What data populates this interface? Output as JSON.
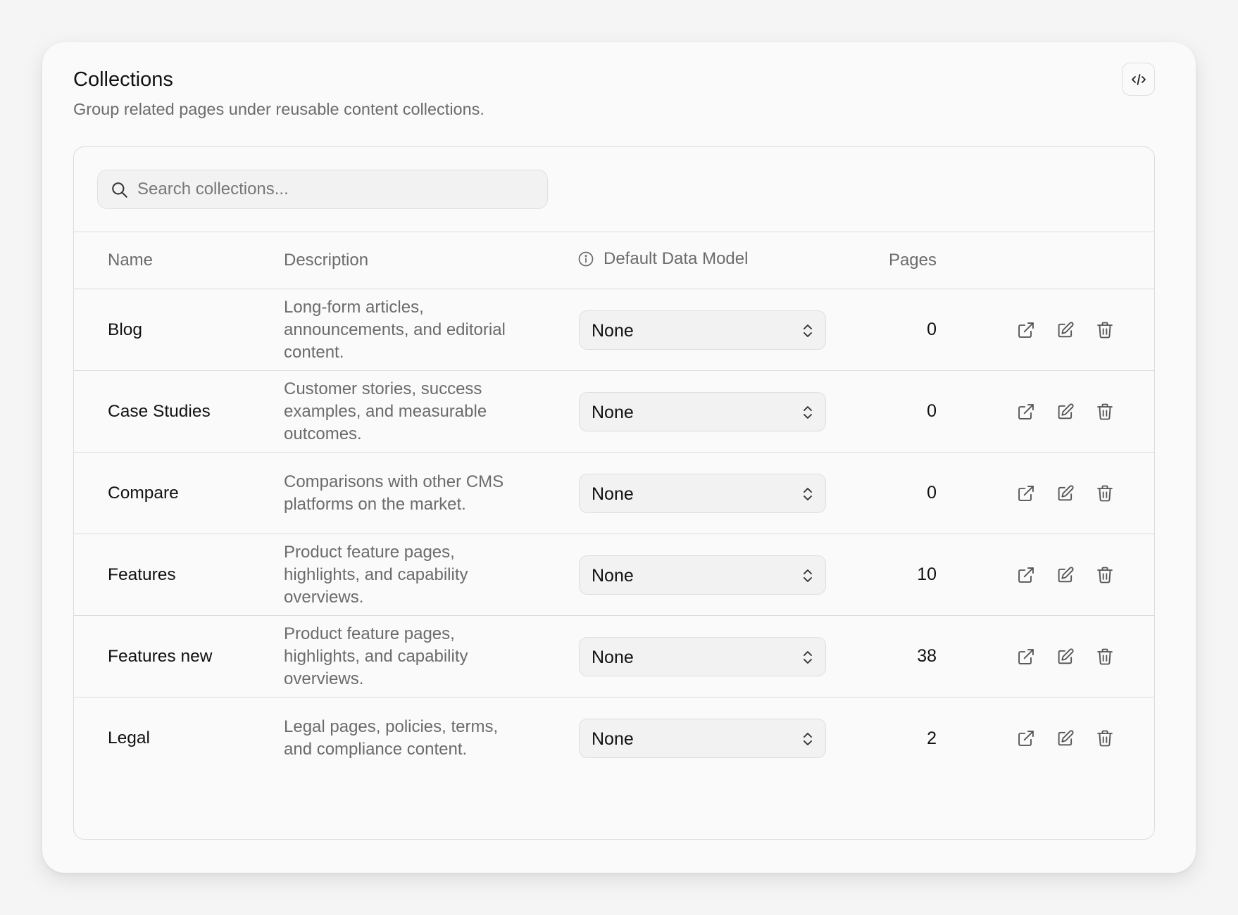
{
  "header": {
    "title": "Collections",
    "subtitle": "Group related pages under reusable content collections."
  },
  "toolbar": {
    "code_icon": "code-icon"
  },
  "search": {
    "placeholder": "Search collections...",
    "value": ""
  },
  "table": {
    "columns": {
      "name": "Name",
      "description": "Description",
      "model": "Default Data Model",
      "pages": "Pages"
    },
    "rows": [
      {
        "name": "Blog",
        "description": "Long-form articles, announcements, and editorial content.",
        "model": "None",
        "pages": "0"
      },
      {
        "name": "Case Studies",
        "description": "Customer stories, success examples, and measurable outcomes.",
        "model": "None",
        "pages": "0"
      },
      {
        "name": "Compare",
        "description": "Comparisons with other CMS platforms on the market.",
        "model": "None",
        "pages": "0"
      },
      {
        "name": "Features",
        "description": "Product feature pages, highlights, and capability overviews.",
        "model": "None",
        "pages": "10"
      },
      {
        "name": "Features new",
        "description": "Product feature pages, highlights, and capability overviews.",
        "model": "None",
        "pages": "38"
      },
      {
        "name": "Legal",
        "description": "Legal pages, policies, terms, and compliance content.",
        "model": "None",
        "pages": "2"
      }
    ],
    "row_actions": [
      "external-link-icon",
      "edit-icon",
      "trash-icon"
    ]
  }
}
